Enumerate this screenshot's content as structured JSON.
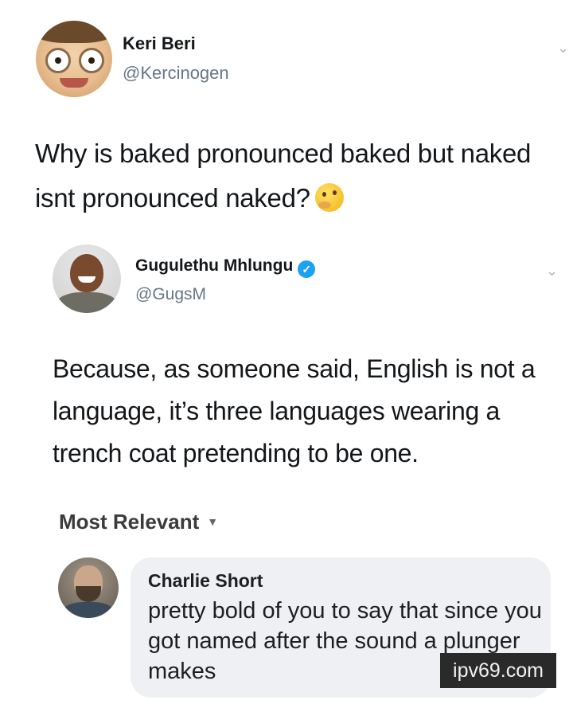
{
  "tweet_original": {
    "author_name": "Keri Beri",
    "author_handle": "@Kercinogen",
    "text": "Why is baked pronounced baked but naked isnt pronounced naked?",
    "emoji": "thinking-face"
  },
  "tweet_reply": {
    "author_name": "Gugulethu Mhlungu",
    "author_handle": "@GugsM",
    "verified_mark": "✓",
    "text": "Because, as someone said, English is not a language, it’s three languages wearing a trench coat pretending to be one."
  },
  "comments": {
    "sort_label": "Most Relevant",
    "items": [
      {
        "author_name": "Charlie Short",
        "text": "pretty bold of you to say that since you got named after the sound a plunger makes"
      }
    ]
  },
  "watermark": {
    "text": "ipv69.com"
  },
  "icons": {
    "menu_caret": "chevron-down-icon",
    "verified": "verified-badge-icon"
  },
  "colors": {
    "text_primary": "#14171a",
    "text_secondary": "#657786",
    "verified_blue": "#1da1f2",
    "comment_bubble": "#eff0f3"
  }
}
